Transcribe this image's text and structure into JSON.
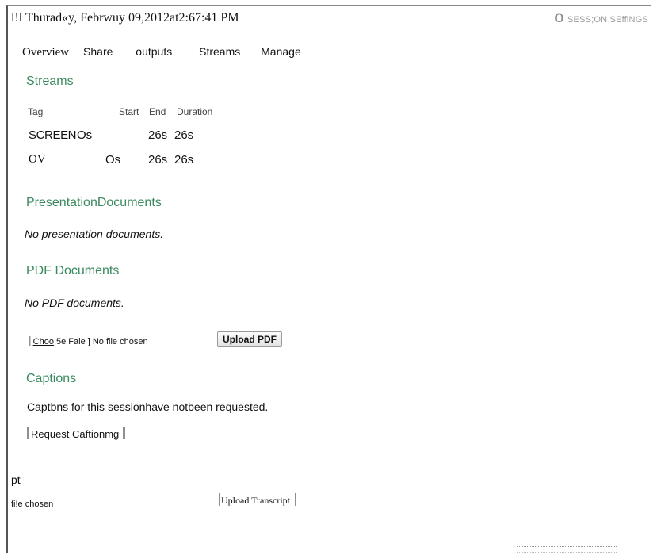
{
  "header": {
    "timestamp_prefix": "l!l",
    "timestamp": "Thurad«y, Febrwuy 09,2012at2:67:41 PM",
    "settings_icon_glyph": "O",
    "settings_label": "SESS;ON SEffiNGS"
  },
  "nav": {
    "items": [
      "Overview",
      "Share",
      "outputs",
      "Streams",
      "Manage"
    ]
  },
  "streams": {
    "title": "Streams",
    "columns": [
      "Tag",
      "Start",
      "End",
      "Duration"
    ],
    "rows": [
      {
        "tag": "SCREEN",
        "start": "Os",
        "end": "26s",
        "duration": "26s"
      },
      {
        "tag": "OV",
        "start": "Os",
        "end": "26s",
        "duration": "26s"
      }
    ]
  },
  "presentation": {
    "title": "PresentationDocuments",
    "empty": "No presentation documents."
  },
  "pdf": {
    "title": "PDF Documents",
    "empty": "No PDF documents.",
    "choose_label": "Choo",
    "choose_suffix": "5e Fale ] No file chosen",
    "upload_label": "Upload PDF"
  },
  "captions": {
    "title": "Captions",
    "text": "Captbns for this sessionhave notbeen requested.",
    "request_label": "Request Caftionmg"
  },
  "transcript": {
    "label": "pt",
    "file_chosen": "fi!e chosen",
    "upload_label": "Upload Transcript"
  },
  "colors": {
    "accent": "#3a8a5e",
    "muted": "#9a9a9a"
  }
}
